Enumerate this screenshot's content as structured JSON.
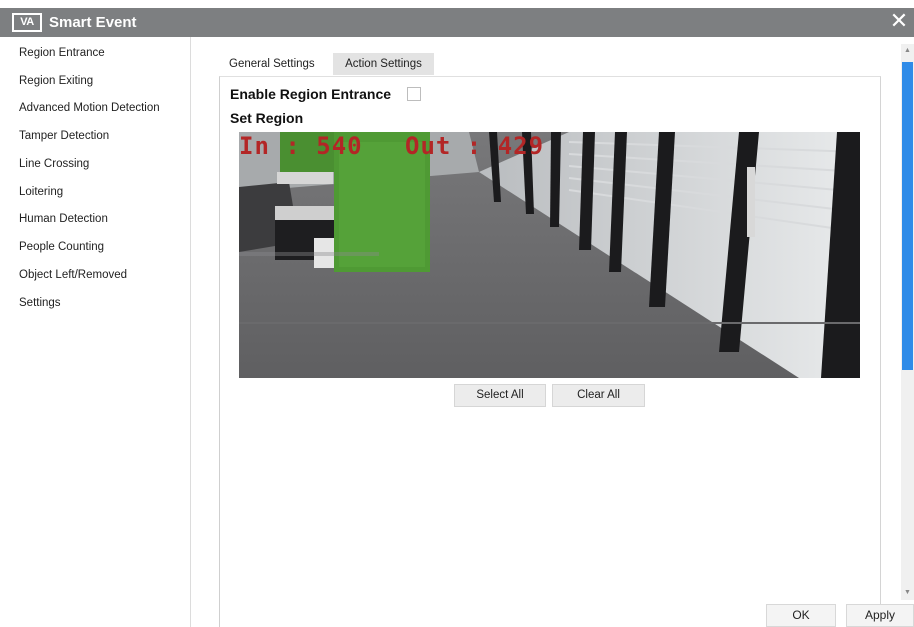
{
  "window": {
    "logo_text": "VA",
    "title": "Smart Event",
    "close_glyph": "✕"
  },
  "sidebar": {
    "items": [
      {
        "label": "Region Entrance"
      },
      {
        "label": "Region Exiting"
      },
      {
        "label": "Advanced Motion Detection"
      },
      {
        "label": "Tamper Detection"
      },
      {
        "label": "Line Crossing"
      },
      {
        "label": "Loitering"
      },
      {
        "label": "Human Detection"
      },
      {
        "label": "People Counting"
      },
      {
        "label": "Object Left/Removed"
      },
      {
        "label": "Settings"
      }
    ]
  },
  "tabs": {
    "general": "General Settings",
    "action": "Action Settings",
    "active": "action"
  },
  "settings": {
    "enable_label": "Enable Region Entrance",
    "enable_checked": false,
    "set_region_label": "Set Region"
  },
  "video": {
    "overlay_in": "In : 540",
    "overlay_out": "Out : 429"
  },
  "buttons": {
    "select_all": "Select All",
    "clear_all": "Clear All",
    "ok": "OK",
    "apply": "Apply"
  },
  "colors": {
    "titlebar": "#7d7f81",
    "scroll_thumb": "#2f8be8",
    "overlay_text": "#b32626",
    "active_tab": "#e3e3e3"
  },
  "icons": {
    "close": "close-icon",
    "scroll_up": "scroll-up-arrow-icon",
    "scroll_down": "scroll-down-arrow-icon",
    "logo": "va-logo-icon"
  }
}
